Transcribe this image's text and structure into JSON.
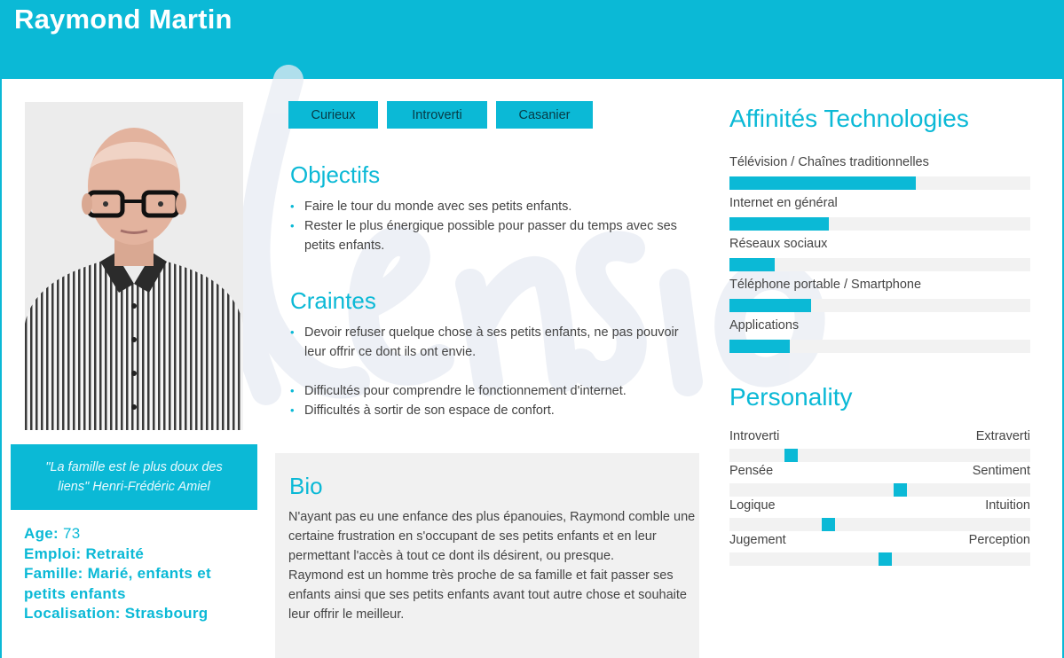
{
  "persona": {
    "name": "Raymond Martin",
    "quote": "\"La famille est le plus doux des liens\" Henri-Frédéric Amiel",
    "facts": [
      {
        "label": "Age:",
        "value": "73"
      },
      {
        "label": "Emploi:",
        "value": "Retraité"
      },
      {
        "label": "Famille:",
        "value": "Marié, enfants et petits enfants"
      },
      {
        "label": "Localisation:",
        "value": "Strasbourg"
      }
    ]
  },
  "tags": [
    "Curieux",
    "Introverti",
    "Casanier"
  ],
  "objectifs": {
    "title": "Objectifs",
    "items": [
      "Faire le tour du monde avec ses petits enfants.",
      "Rester le plus énergique possible pour passer du temps avec ses petits enfants."
    ]
  },
  "craintes": {
    "title": "Craintes",
    "items": [
      "Devoir refuser quelque chose à ses petits enfants, ne pas pouvoir leur offrir ce dont ils ont envie.",
      "Difficultés pour comprendre le fonctionnement d'internet.",
      "Difficultés à sortir de son espace de confort."
    ]
  },
  "bio": {
    "title": "Bio",
    "paragraphs": [
      "N'ayant pas eu une enfance des plus épanouies, Raymond comble une certaine frustration en s'occupant de ses petits enfants et en leur permettant l'accès à tout ce dont ils désirent, ou presque.",
      "Raymond est un homme très proche de sa famille et fait passer ses enfants ainsi que ses petits enfants avant tout autre chose et souhaite leur offrir le meilleur."
    ]
  },
  "tech": {
    "title": "Affinités Technologies",
    "items": [
      {
        "label": "Télévision / Chaînes traditionnelles",
        "level": 0.62
      },
      {
        "label": "Internet en général",
        "level": 0.33
      },
      {
        "label": "Réseaux sociaux",
        "level": 0.15
      },
      {
        "label": "Téléphone portable / Smartphone",
        "level": 0.27
      },
      {
        "label": "Applications",
        "level": 0.2
      }
    ]
  },
  "personality": {
    "title": "Personality",
    "items": [
      {
        "left": "Introverti",
        "right": "Extraverti",
        "level": 0.19
      },
      {
        "left": "Pensée",
        "right": "Sentiment",
        "level": 0.57
      },
      {
        "left": "Logique",
        "right": "Intuition",
        "level": 0.32
      },
      {
        "left": "Jugement",
        "right": "Perception",
        "level": 0.52
      }
    ]
  },
  "colors": {
    "accent": "#0bb9d6",
    "track": "#f2f2f2",
    "bio_bg": "#f1f1f1"
  },
  "watermark": "Klensio"
}
